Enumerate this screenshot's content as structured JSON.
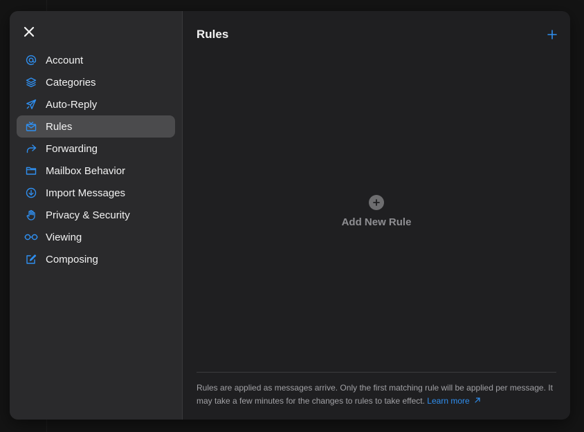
{
  "settings": {
    "nav": [
      {
        "label": "Account",
        "icon": "at-sign-icon"
      },
      {
        "label": "Categories",
        "icon": "layers-icon"
      },
      {
        "label": "Auto-Reply",
        "icon": "paper-plane-icon"
      },
      {
        "label": "Rules",
        "icon": "mail-filter-icon",
        "active": true
      },
      {
        "label": "Forwarding",
        "icon": "forward-arrow-icon"
      },
      {
        "label": "Mailbox Behavior",
        "icon": "folder-icon"
      },
      {
        "label": "Import Messages",
        "icon": "download-circle-icon"
      },
      {
        "label": "Privacy & Security",
        "icon": "hand-icon"
      },
      {
        "label": "Viewing",
        "icon": "glasses-icon"
      },
      {
        "label": "Composing",
        "icon": "compose-icon"
      }
    ]
  },
  "main": {
    "title": "Rules",
    "empty_label": "Add New Rule",
    "footer_text": "Rules are applied as messages arrive. Only the first matching rule will be applied per message. It may take a few minutes for the changes to rules to take effect.",
    "learn_more": "Learn more"
  },
  "colors": {
    "accent": "#2f8ff0",
    "sidebar_bg": "#2a2a2c",
    "main_bg": "#1f1f21",
    "active_item": "#4b4b4d"
  }
}
